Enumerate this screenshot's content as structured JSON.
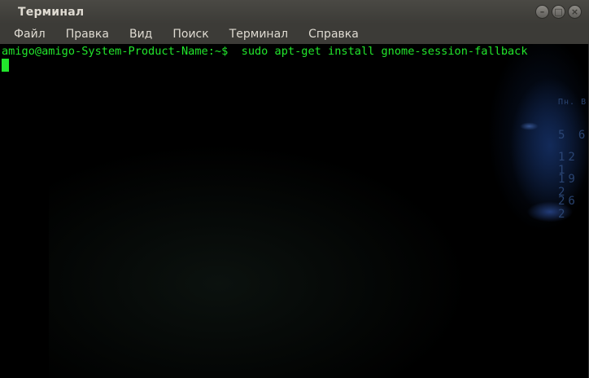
{
  "window": {
    "title": "Терминал",
    "buttons": [
      "minimize",
      "maximize",
      "close"
    ]
  },
  "menubar": {
    "items": [
      "Файл",
      "Правка",
      "Вид",
      "Поиск",
      "Терминал",
      "Справка"
    ]
  },
  "terminal": {
    "prompt": "amigo@amigo-System-Product-Name:~$",
    "command": "  sudo apt-get install gnome-session-fallback",
    "text_color": "#22e62c"
  },
  "background_calendar": {
    "header": "Пн. В",
    "rows": [
      "5  6",
      "12 1",
      "19 2",
      "26 2"
    ]
  }
}
